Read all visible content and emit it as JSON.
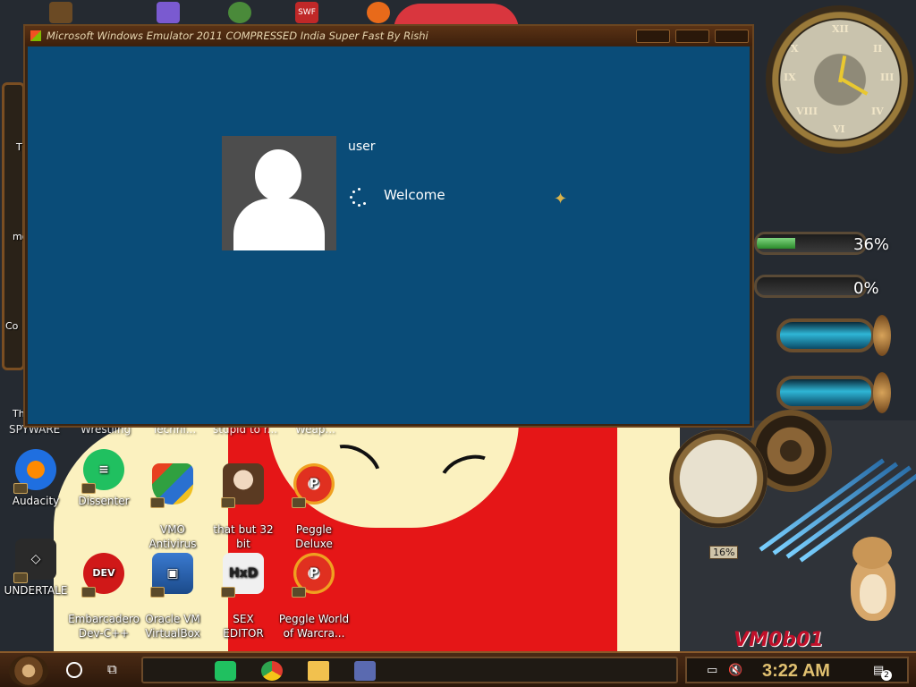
{
  "window": {
    "title": "Microsoft Windows Emulator 2011 COMPRESSED India Super Fast By Rishi",
    "btn_min": "",
    "btn_max": "",
    "btn_close": ""
  },
  "login": {
    "username": "user",
    "status": "Welcome"
  },
  "desktop_icons": [
    {
      "label": "Audacity",
      "color": "#1f6fe0"
    },
    {
      "label": "Dissenter",
      "color": "#20c060"
    },
    {
      "label": "VMO\nAntivirus",
      "color": "#3a74c8"
    },
    {
      "label": "that but 32\nbit",
      "color": "#c9a884"
    },
    {
      "label": "Peggle\nDeluxe",
      "color": "#e03020"
    },
    {
      "label": "UNDERTALE",
      "color": "#2a2a2a"
    },
    {
      "label": "Embarcadero\nDev-C++",
      "color": "#d01818"
    },
    {
      "label": "Oracle VM\nVirtualBox",
      "color": "#1b5aa6"
    },
    {
      "label": "SEX\nEDITOR",
      "color": "#e8e8e8"
    },
    {
      "label": "Peggle World\nof Warcra...",
      "color": "#e03020"
    }
  ],
  "partial_labels": [
    "SPYWARE",
    "Wrestling",
    "Techni...",
    "stupid to r...",
    "Weap..."
  ],
  "left_rail": [
    "T",
    "mo",
    "Co",
    "Th"
  ],
  "gadgets": {
    "meter1_percent": "36%",
    "meter2_percent": "0%",
    "meter1_value": 0.36,
    "meter2_value": 0.0,
    "gauge_percent": "16%",
    "vm_logo": "VM0b01",
    "clock_numerals": [
      "XII",
      "III",
      "VI",
      "IX",
      "X",
      "II",
      "VIII",
      "IV"
    ]
  },
  "taskbar": {
    "time": "3:22 AM",
    "notification_count": "2",
    "apps": [
      "spotify-icon",
      "chrome-icon",
      "file-explorer-icon",
      "virtualbox-icon"
    ]
  },
  "colors": {
    "login_bg": "#0a4c78",
    "taskbar_accent": "#e0c070"
  }
}
